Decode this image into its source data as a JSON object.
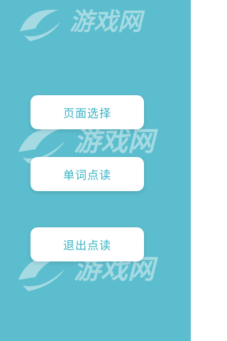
{
  "colors": {
    "background": "#5bbdcd",
    "button_background": "#ffffff",
    "button_text": "#3bb3c3",
    "watermark": "#ffffff"
  },
  "watermark": {
    "icon": "swirl-logo-icon",
    "text": "游戏网"
  },
  "menu": {
    "buttons": [
      {
        "label": "页面选择"
      },
      {
        "label": "单词点读"
      },
      {
        "label": "退出点读"
      }
    ]
  }
}
